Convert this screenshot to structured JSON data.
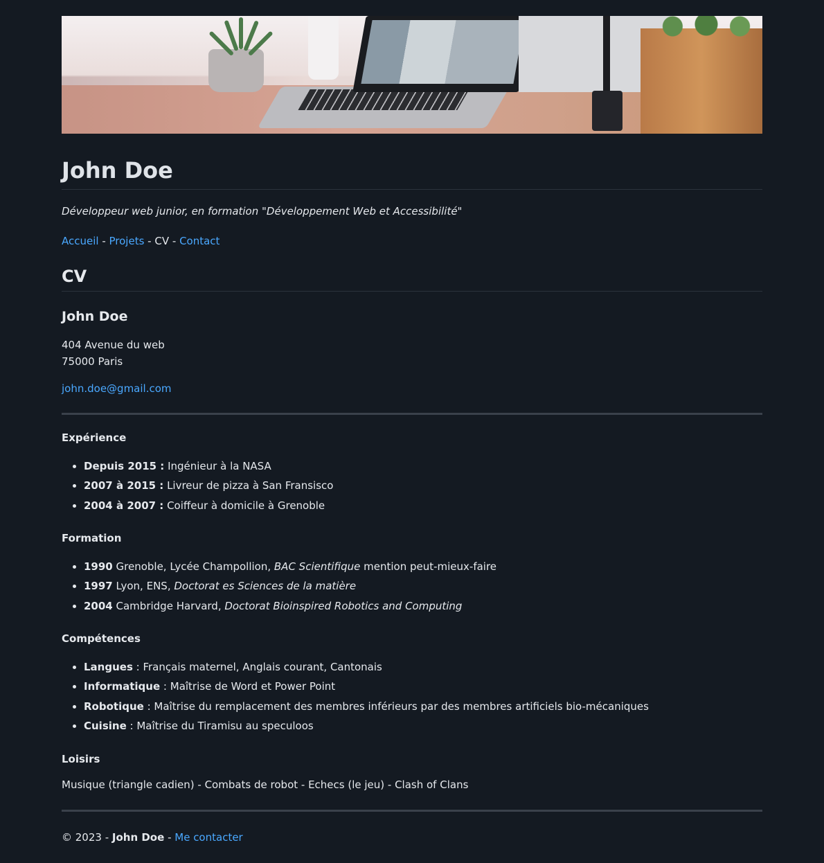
{
  "header": {
    "title": "John Doe",
    "tagline": "Développeur web junior, en formation \"Développement Web et Accessibilité\""
  },
  "nav": {
    "home": "Accueil",
    "projects": "Projets",
    "current": "CV",
    "contact": "Contact",
    "separator": " - "
  },
  "cv": {
    "section_title": "CV",
    "name": "John Doe",
    "address_line1": "404 Avenue du web",
    "address_line2": "75000 Paris",
    "email": "john.doe@gmail.com",
    "experience": {
      "title": "Expérience",
      "items": [
        {
          "period": "Depuis 2015 :",
          "text": " Ingénieur à la NASA"
        },
        {
          "period": "2007 à 2015 :",
          "text": " Livreur de pizza à San Fransisco"
        },
        {
          "period": "2004 à 2007 :",
          "text": " Coiffeur à domicile à Grenoble"
        }
      ]
    },
    "education": {
      "title": "Formation",
      "items": [
        {
          "year": "1990",
          "place": " Grenoble, Lycée Champollion, ",
          "degree": "BAC Scientifique",
          "extra": " mention peut-mieux-faire"
        },
        {
          "year": "1997",
          "place": " Lyon, ENS, ",
          "degree": "Doctorat es Sciences de la matière",
          "extra": ""
        },
        {
          "year": "2004",
          "place": " Cambridge Harvard, ",
          "degree": "Doctorat Bioinspired Robotics and Computing",
          "extra": ""
        }
      ]
    },
    "skills": {
      "title": "Compétences",
      "items": [
        {
          "label": "Langues",
          "text": " : Français maternel, Anglais courant, Cantonais"
        },
        {
          "label": "Informatique",
          "text": " : Maîtrise de Word et Power Point"
        },
        {
          "label": "Robotique",
          "text": " : Maîtrise du remplacement des membres inférieurs par des membres artificiels bio-mécaniques"
        },
        {
          "label": "Cuisine",
          "text": " : Maîtrise du Tiramisu au speculoos"
        }
      ]
    },
    "hobbies": {
      "title": "Loisirs",
      "text": "Musique (triangle cadien) - Combats de robot - Echecs (le jeu) - Clash of Clans"
    }
  },
  "footer": {
    "copyright": "© 2023 - ",
    "name": "John Doe",
    "separator": " - ",
    "contact_link": "Me contacter"
  },
  "colors": {
    "background": "#141a22",
    "link": "#4aa8ff",
    "text": "#e6e9ed"
  }
}
